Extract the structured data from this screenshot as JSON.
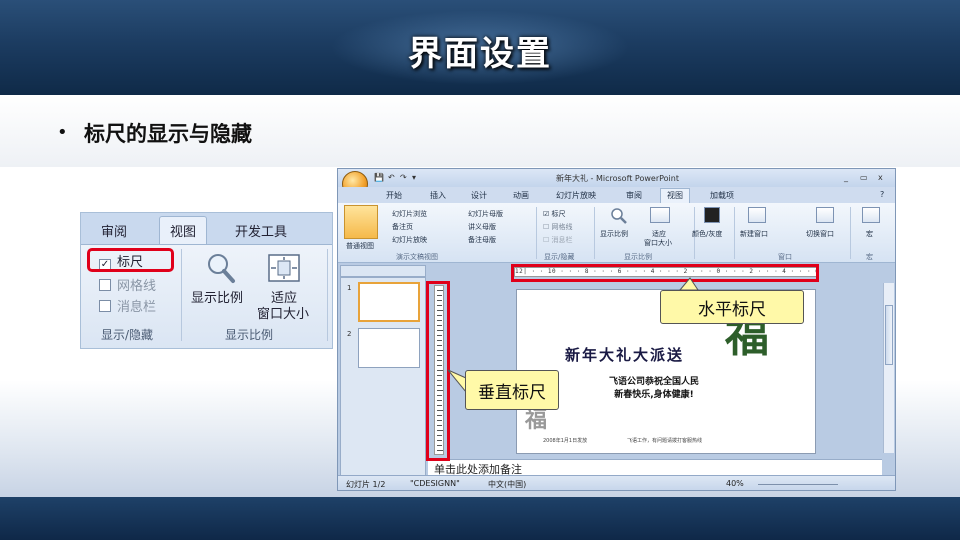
{
  "slide": {
    "title": "界面设置",
    "bullet_marker": "•",
    "bullet_text": "标尺的显示与隐藏"
  },
  "zoom_panel": {
    "tabs": [
      "审阅",
      "视图",
      "开发工具"
    ],
    "active_tab": "视图",
    "checkboxes": [
      {
        "label": "标尺",
        "checked": true
      },
      {
        "label": "网格线",
        "checked": false
      },
      {
        "label": "消息栏",
        "checked": false
      }
    ],
    "zoom_label": "显示比例",
    "fit_label_line1": "适应",
    "fit_label_line2": "窗口大小",
    "group_show_hide": "显示/隐藏",
    "group_zoom": "显示比例"
  },
  "ppt": {
    "window_title": "新年大礼 - Microsoft PowerPoint",
    "win_controls": [
      "_",
      "▭",
      "x"
    ],
    "quick_access": [
      "💾",
      "↶",
      "↷",
      "▾"
    ],
    "tabs": [
      "开始",
      "插入",
      "设计",
      "动画",
      "幻灯片放映",
      "审阅",
      "视图",
      "加载项"
    ],
    "active_tab": "视图",
    "ribbon": {
      "normal_view": "普通视图",
      "views": [
        "幻灯片浏览",
        "备注页",
        "幻灯片放映"
      ],
      "masters": [
        "幻灯片母版",
        "讲义母版",
        "备注母版"
      ],
      "group_views": "演示文稿视图",
      "checks": [
        "标尺",
        "网格线",
        "消息栏"
      ],
      "group_show": "显示/隐藏",
      "zoom": "显示比例",
      "fit_line1": "适应",
      "fit_line2": "窗口大小",
      "group_zoom": "显示比例",
      "color": "颜色/灰度",
      "new_window": "新建窗口",
      "switch_window": "切换窗口",
      "group_window": "窗口",
      "macro": "宏",
      "group_macro": "宏"
    },
    "h_ruler": "12| · · 10 · · · 8 · · · 6 · · · 4 · · · 2 · · · 0 · · · 2 · · · 4 · · · 6 · · · 8 · · · 10 · · 12",
    "thumb_numbers": [
      "1",
      "2"
    ],
    "slide_content": {
      "title": "新年大礼大派送",
      "sub_line1": "飞语公司恭祝全国人民",
      "sub_line2": "新春快乐,身体健康!",
      "foot_left": "2008年1月1日发放",
      "foot_right": "飞语工作，有问题请拨打客服热线"
    },
    "notes_placeholder": "单击此处添加备注",
    "status": {
      "slide": "幻灯片 1/2",
      "theme": "\"CDESIGNN\"",
      "lang": "中文(中国)",
      "zoom": "40%"
    }
  },
  "callouts": {
    "horizontal": "水平标尺",
    "vertical": "垂直标尺"
  },
  "colors": {
    "header_blue": "#1c3c61",
    "highlight_red": "#e0001a",
    "callout_yellow": "#fff9a8"
  }
}
